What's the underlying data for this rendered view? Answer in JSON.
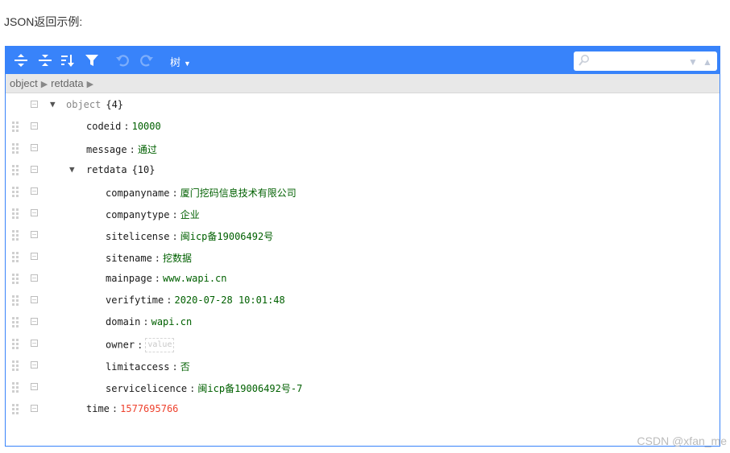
{
  "heading": "JSON返回示例:",
  "toolbar": {
    "mode_label": "树",
    "accent": "#3883fa"
  },
  "breadcrumb": [
    "object",
    "retdata"
  ],
  "tree": {
    "root": {
      "name": "object",
      "count": "{4}"
    },
    "codeid": {
      "key": "codeid",
      "value": "10000"
    },
    "message": {
      "key": "message",
      "value": "通过"
    },
    "retdata": {
      "key": "retdata",
      "count": "{10}"
    },
    "companyname": {
      "key": "companyname",
      "value": "厦门挖码信息技术有限公司"
    },
    "companytype": {
      "key": "companytype",
      "value": "企业"
    },
    "sitelicense": {
      "key": "sitelicense",
      "value": "闽icp备19006492号"
    },
    "sitename": {
      "key": "sitename",
      "value": "挖数据"
    },
    "mainpage": {
      "key": "mainpage",
      "value": "www.wapi.cn"
    },
    "verifytime": {
      "key": "verifytime",
      "value": "2020-07-28 10:01:48"
    },
    "domain": {
      "key": "domain",
      "value": "wapi.cn"
    },
    "owner": {
      "key": "owner",
      "value_placeholder": "value"
    },
    "limitaccess": {
      "key": "limitaccess",
      "value": "否"
    },
    "servicelicence": {
      "key": "servicelicence",
      "value": "闽icp备19006492号-7"
    },
    "time": {
      "key": "time",
      "value": "1577695766"
    }
  },
  "watermark": "CSDN @xfan_me"
}
